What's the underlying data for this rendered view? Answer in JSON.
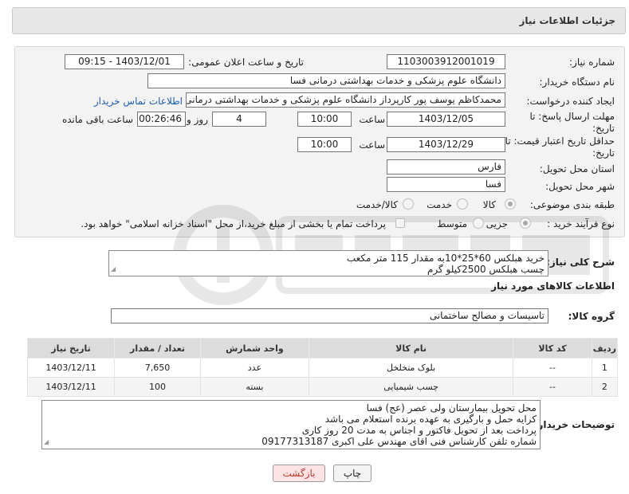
{
  "header": {
    "title": "جزئیات اطلاعات نیاز"
  },
  "form": {
    "need_number_label": "شماره نیاز:",
    "need_number": "1103003912001019",
    "announce_label": "تاریخ و ساعت اعلان عمومی:",
    "announce_value": "1403/12/01 - 09:15",
    "buyer_label": "نام دستگاه خریدار:",
    "buyer_value": "دانشگاه علوم پزشکی و خدمات بهداشتی درمانی فسا",
    "creator_label": "ایجاد کننده درخواست:",
    "creator_value": "محمدکاظم یوسف پور کارپرداز دانشگاه علوم پزشکی و خدمات بهداشتی درمانی فسا",
    "contact_link": "اطلاعات تماس خریدار",
    "deadline_label_1": "مهلت ارسال پاسخ: تا",
    "deadline_label_2": "تاریخ:",
    "deadline_date": "1403/12/05",
    "time_label": "ساعت",
    "deadline_time": "10:00",
    "days_value": "4",
    "days_label": "روز و",
    "remaining_value": "00:26:46",
    "remaining_label": "ساعت باقی مانده",
    "validity_label_1": "حداقل تاریخ اعتبار قیمت: تا",
    "validity_label_2": "تاریخ:",
    "validity_date": "1403/12/29",
    "validity_time_label": "ساعت",
    "validity_time": "10:00",
    "province_label": "استان محل تحویل:",
    "province_value": "فارس",
    "city_label": "شهر محل تحویل:",
    "city_value": "فسا",
    "category_label": "طبقه بندی موضوعی:",
    "category_options": [
      "کالا",
      "خدمت",
      "کالا/خدمت"
    ],
    "category_selected": "کالا",
    "process_label": "نوع فرآیند خرید :",
    "process_options": [
      "جزیی",
      "متوسط"
    ],
    "process_selected": "جزیی",
    "payment_note": "پرداخت تمام یا بخشی از مبلغ خرید،از محل \"اسناد خزانه اسلامی\" خواهد بود."
  },
  "summary": {
    "label": "شرح کلی نیاز:",
    "line1": "خرید هبلکس 60*25*10به مقدار 115 متر مکعب",
    "line2": "چسب هبلکس 2500کیلو گرم"
  },
  "goods": {
    "section_title": "اطلاعات کالاهای مورد نیاز",
    "group_label": "گروه کالا:",
    "group_value": "تاسیسات و مصالح ساختمانی",
    "columns": [
      "ردیف",
      "کد کالا",
      "نام کالا",
      "واحد شمارش",
      "تعداد / مقدار",
      "تاریخ نیاز"
    ],
    "rows": [
      [
        "1",
        "--",
        "بلوک متخلخل",
        "عدد",
        "7,650",
        "1403/12/11"
      ],
      [
        "2",
        "--",
        "چسب شیمیایی",
        "بسته",
        "100",
        "1403/12/11"
      ]
    ]
  },
  "notes": {
    "label": "توضیحات خریدار:",
    "lines": [
      "محل تحویل بیمارستان ولی عصر (عج) فسا",
      "کرایه حمل و بارگیری به عهده برنده استعلام می باشد",
      "پرداخت بعد از تحویل فاکتور و اجناس به مدت 20 روز کاری",
      "شماره تلفن کارشناس فنی اقای مهندس علی اکبری 09177313187"
    ]
  },
  "buttons": {
    "print": "چاپ",
    "back": "بازگشت"
  },
  "colors": {
    "link": "#1a5fb4",
    "back_button_bg": "#fde3e3",
    "back_button_text": "#c0392b",
    "header_bg": "#e7e7e7"
  }
}
